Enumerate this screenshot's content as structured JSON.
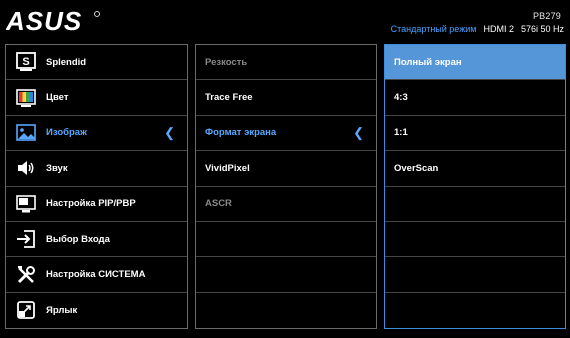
{
  "header": {
    "logo": "ASUS",
    "model": "PB279",
    "mode": "Стандартный режим",
    "input": "HDMI 2",
    "resolution": "576i 50 Hz"
  },
  "main_menu": [
    {
      "label": "Splendid",
      "icon": "splendid-icon"
    },
    {
      "label": "Цвет",
      "icon": "color-icon"
    },
    {
      "label": "Изображ",
      "icon": "image-icon",
      "active": true
    },
    {
      "label": "Звук",
      "icon": "speaker-icon"
    },
    {
      "label": "Настройка PIP/PBP",
      "icon": "pip-icon"
    },
    {
      "label": "Выбор Входа",
      "icon": "input-select-icon"
    },
    {
      "label": "Настройка СИСТЕМА",
      "icon": "tools-icon"
    },
    {
      "label": "Ярлык",
      "icon": "shortcut-icon"
    }
  ],
  "sub_menu": [
    {
      "label": "Резкость",
      "disabled": true
    },
    {
      "label": "Trace Free"
    },
    {
      "label": "Формат экрана",
      "active": true
    },
    {
      "label": "VividPixel"
    },
    {
      "label": "ASCR",
      "disabled": true
    },
    {
      "label": ""
    },
    {
      "label": ""
    },
    {
      "label": ""
    }
  ],
  "options": [
    {
      "label": "Полный экран",
      "selected": true
    },
    {
      "label": "4:3"
    },
    {
      "label": "1:1"
    },
    {
      "label": "OverScan"
    },
    {
      "label": ""
    },
    {
      "label": ""
    },
    {
      "label": ""
    },
    {
      "label": ""
    }
  ],
  "colors": {
    "accent": "#5aa8ff",
    "selected_bg": "#5596d8",
    "border": "#6a6a6a"
  }
}
